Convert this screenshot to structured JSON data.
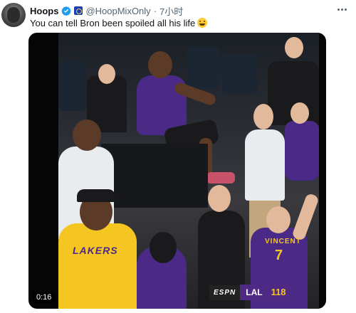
{
  "tweet": {
    "display_name": "Hoops",
    "handle": "@HoopMixOnly",
    "separator": "·",
    "timestamp": "7小时",
    "text": "You can tell Bron been spoiled all his life",
    "emoji_icon": "joy-emoji-icon"
  },
  "media": {
    "video_time": "0:16",
    "scorebug": {
      "network": "ESPN",
      "team": "LAL",
      "score": "118"
    },
    "jersey_front_text": "LAKERS",
    "jersey_back_name": "VINCENT",
    "jersey_back_number": "7"
  },
  "colors": {
    "verified_blue": "#1d9bf0",
    "lakers_purple": "#4a2a86",
    "lakers_gold": "#f5c521",
    "secondary_text": "#536471"
  }
}
